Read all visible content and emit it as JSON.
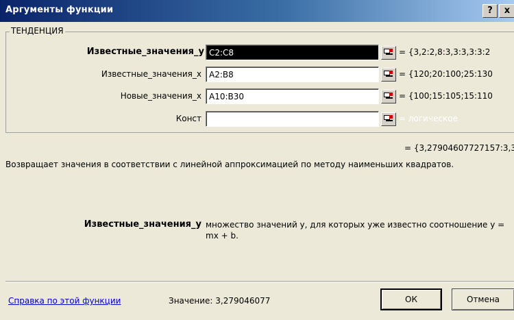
{
  "window": {
    "title": "Аргументы функции",
    "help_label": "?",
    "close_label": "x"
  },
  "function_name": "ТЕНДЕНЦИЯ",
  "arguments": [
    {
      "label": "Известные_значения_y",
      "value": "C2:C8",
      "result": "= {3,2:2,8:3,3:3,3:3:2"
    },
    {
      "label": "Известные_значения_x",
      "value": "A2:B8",
      "result": "= {120;20:100;25:130"
    },
    {
      "label": "Новые_значения_x",
      "value": "A10:B30",
      "result": "= {100;15:105;15:110"
    },
    {
      "label": "Конст",
      "value": "",
      "result": "= логическое"
    }
  ],
  "formula_value": "= {3,27904607727157:3,3",
  "description": "Возвращает значения в соответствии с линейной аппроксимацией по методу наименьших квадратов.",
  "argument_help": {
    "name": "Известные_значения_y",
    "text": "множество значений y, для которых уже известно соотношение y = mx + b."
  },
  "footer": {
    "help_link": "Справка по этой функции",
    "value_text": "Значение: 3,279046077",
    "ok_label": "ОК",
    "cancel_label": "Отмена"
  },
  "colors": {
    "title_gradient_start": "#0a246a",
    "title_gradient_end": "#a6caf0",
    "dialog_bg": "#ece9d8",
    "link": "#0000cc"
  }
}
